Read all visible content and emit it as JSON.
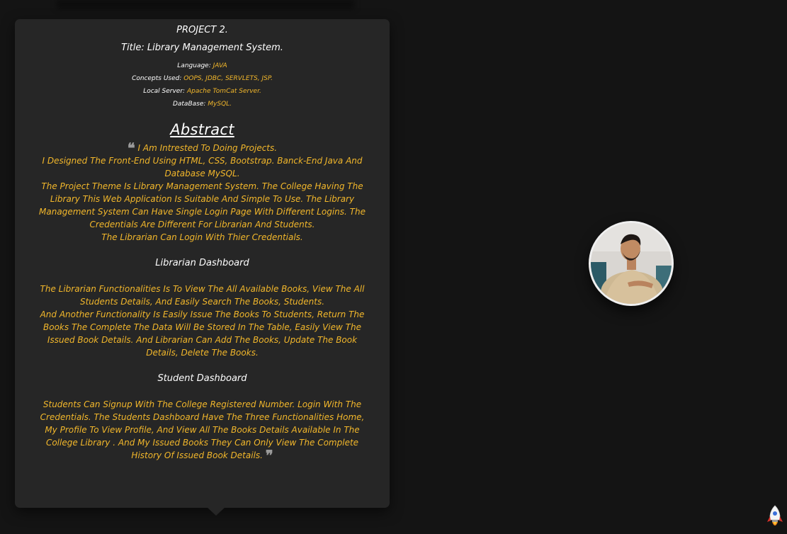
{
  "project": {
    "number": "PROJECT 2.",
    "title": "Title: Library Management System.",
    "meta": [
      {
        "label": "Language:",
        "value": "JAVA"
      },
      {
        "label": "Concepts Used:",
        "value": "OOPS, JDBC, SERVLETS, JSP."
      },
      {
        "label": "Local Server:",
        "value": "Apache TomCat Server."
      },
      {
        "label": "DataBase:",
        "value": "MySQL."
      }
    ]
  },
  "abstract": {
    "heading": "Abstract",
    "lines": [
      "I Am Intrested To Doing Projects.",
      "I Designed The Front-End Using HTML, CSS, Bootstrap. Banck-End Java And Database MySQL.",
      "The Project Theme Is Library Management System. The College Having The Library This Web Application Is Suitable And Simple To Use. The Library Management System Can Have Single Login Page With Different Logins. The Credentials Are Different For Librarian And Students.",
      "The Librarian Can Login With Thier Credentials."
    ]
  },
  "librarian": {
    "title": "Librarian Dashboard",
    "lines": [
      "The Librarian Functionalities Is To View The All Available Books, View The All Students Details, And Easily Search The Books, Students.",
      "And Another Functionality Is Easily Issue The Books To Students, Return The Books The Complete The Data Will Be Stored In The Table, Easily View The Issued Book Details. And Librarian Can Add The Books, Update The Book Details, Delete The Books."
    ]
  },
  "student": {
    "title": "Student Dashboard",
    "text": "Students Can Signup With The College Registered Number. Login With The Credentials. The Students Dashboard Have The Three Functionalities Home, My Profile To View Profile, And View All The Books Details Available In The College Library . And My Issued Books They Can Only View The Complete History Of Issued Book Details."
  },
  "icons": {
    "quote_open": "quote-left-icon",
    "quote_close": "quote-right-icon",
    "scroll_top": "rocket-icon"
  },
  "colors": {
    "background": "#141414",
    "card": "#262626",
    "accent": "#f2b72b",
    "text": "#ffffff"
  }
}
